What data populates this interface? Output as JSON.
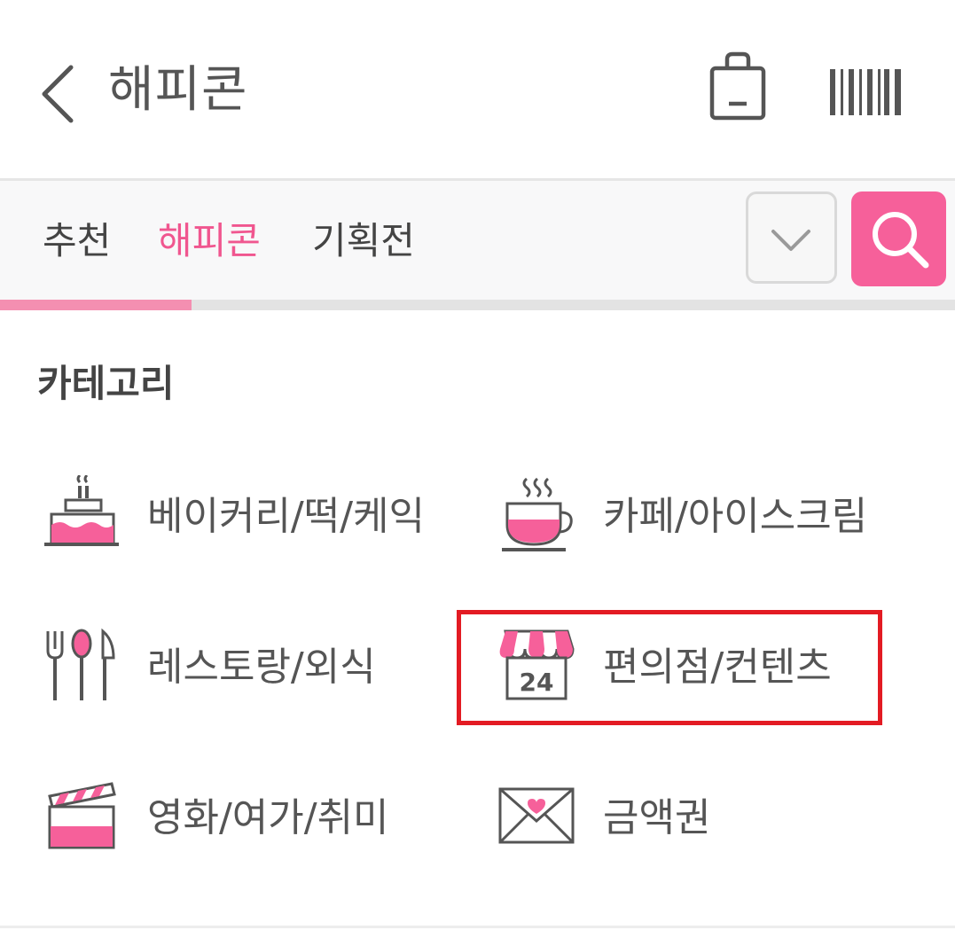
{
  "header": {
    "title": "해피콘",
    "icons": {
      "back": "back-chevron-icon",
      "bag": "shopping-bag-icon",
      "barcode": "barcode-icon"
    }
  },
  "tabs": [
    {
      "label": "추천",
      "active": false
    },
    {
      "label": "해피콘",
      "active": true
    },
    {
      "label": "기획전",
      "active": false
    }
  ],
  "toolbar": {
    "dropdown_icon": "chevron-down-icon",
    "search_icon": "search-icon"
  },
  "section": {
    "title": "카테고리"
  },
  "categories": [
    {
      "label": "베이커리/떡/케익",
      "icon": "cake-icon"
    },
    {
      "label": "카페/아이스크림",
      "icon": "coffee-cup-icon"
    },
    {
      "label": "레스토랑/외식",
      "icon": "cutlery-icon"
    },
    {
      "label": "편의점/컨텐츠",
      "icon": "store-24-icon",
      "highlighted": true
    },
    {
      "label": "영화/여가/취미",
      "icon": "clapperboard-icon"
    },
    {
      "label": "금액권",
      "icon": "envelope-heart-icon"
    }
  ],
  "colors": {
    "accent": "#f6609a",
    "highlight_border": "#e31b23",
    "text": "#555555"
  }
}
